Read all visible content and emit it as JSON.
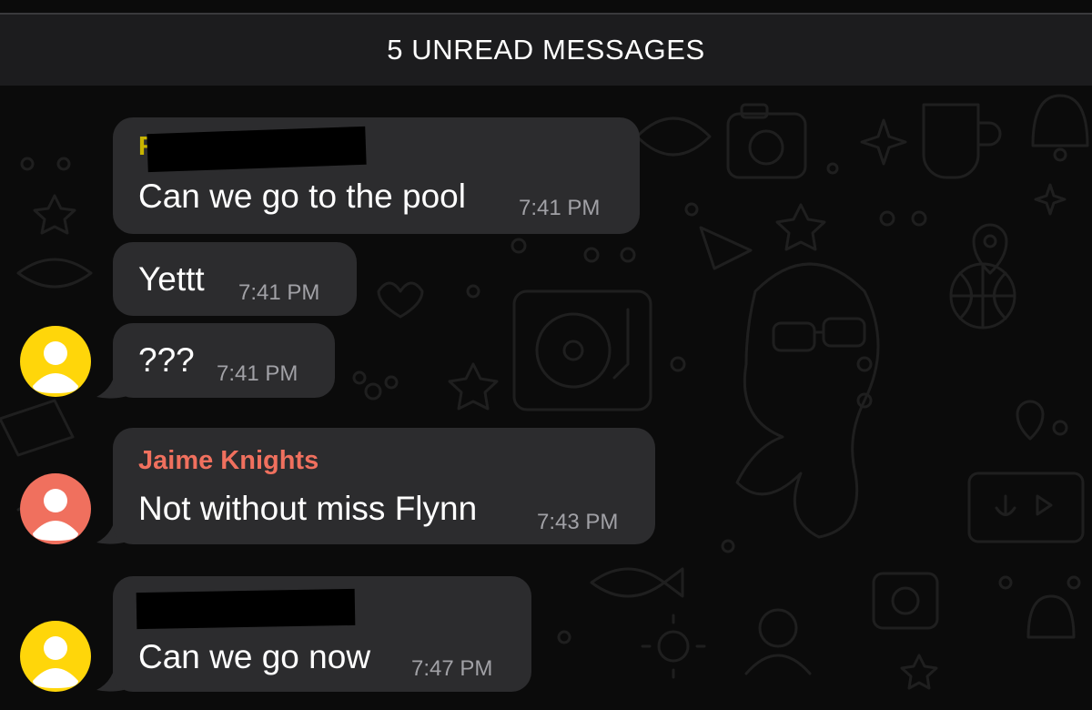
{
  "banner": {
    "text": "5 UNREAD MESSAGES"
  },
  "messages": [
    {
      "sender": "R",
      "text": "Can we go to the pool",
      "time": "7:41 PM"
    },
    {
      "text": "Yettt",
      "time": "7:41 PM"
    },
    {
      "text": "???",
      "time": "7:41 PM"
    },
    {
      "sender": "Jaime Knights",
      "text": "Not without miss Flynn",
      "time": "7:43 PM"
    },
    {
      "text": "Can we go now",
      "time": "7:47 PM"
    }
  ],
  "colors": {
    "bubble": "#2c2c2e",
    "avatar_yellow": "#ffd60a",
    "avatar_coral": "#f0705e",
    "sender_jaime": "#f0705e",
    "sender_r": "#c8b400",
    "time": "#a1a1a6",
    "banner_bg": "#1c1c1e"
  },
  "icons": [
    "user-avatar-icon",
    "doodle-wallpaper"
  ]
}
